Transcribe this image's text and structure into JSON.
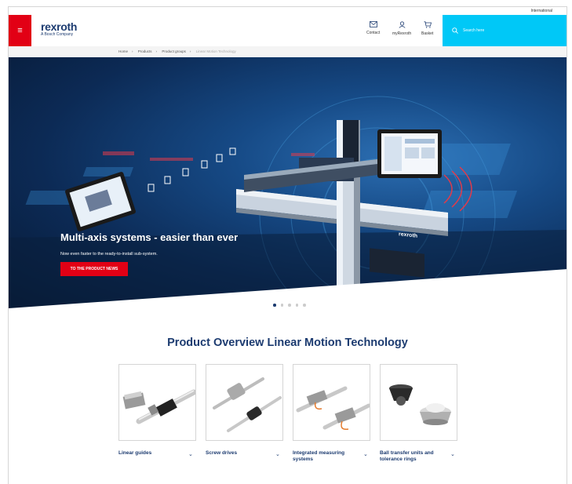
{
  "topbar": {
    "international": "International"
  },
  "header": {
    "menu_icon": "hamburger-icon",
    "logo_brand": "rexroth",
    "logo_sub": "A Bosch Company",
    "contact": "Contact",
    "myrexroth": "myRexroth",
    "basket": "Basket",
    "search_placeholder": "Search here"
  },
  "breadcrumb": [
    "Home",
    "Products",
    "Product groups",
    "Linear Motion Technology"
  ],
  "hero": {
    "title": "Multi-axis systems - easier than ever",
    "subtitle": "Now even faster to the ready-to-install sub-system.",
    "button": "TO THE PRODUCT NEWS",
    "product_logo": "rexroth",
    "slides_total": 5,
    "active_slide": 1
  },
  "section": {
    "title": "Product Overview Linear Motion Technology"
  },
  "products": [
    {
      "label": "Linear guides"
    },
    {
      "label": "Screw drives"
    },
    {
      "label": "Integrated measuring systems"
    },
    {
      "label": "Ball transfer units and tolerance rings"
    }
  ],
  "colors": {
    "brand_red": "#e20015",
    "brand_blue": "#1c3b70",
    "search_cyan": "#00c8f7"
  }
}
